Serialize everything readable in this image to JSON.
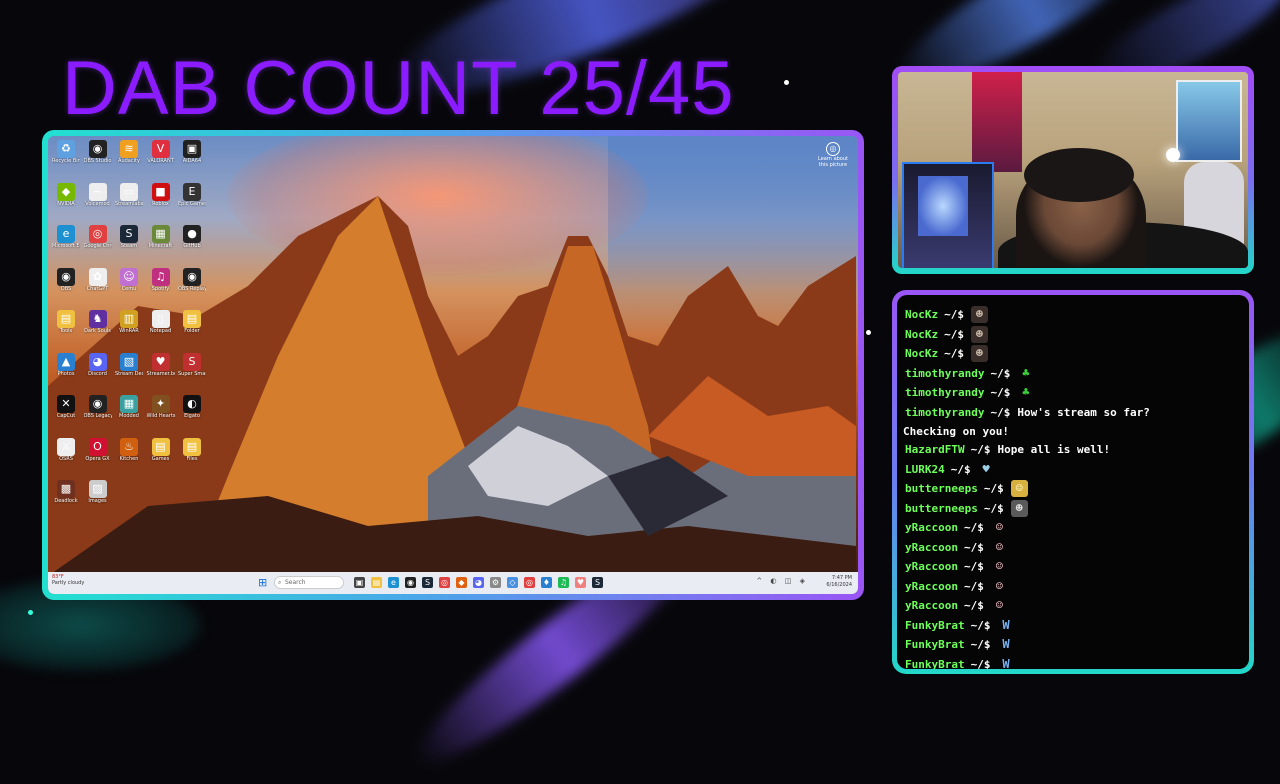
{
  "overlay": {
    "title": "DAB COUNT 25/45"
  },
  "desktop": {
    "icons": [
      {
        "label": "Recycle Bin",
        "color": "#5ea0e0",
        "glyph": "♻"
      },
      {
        "label": "OBS Studio",
        "color": "#222",
        "glyph": "◉"
      },
      {
        "label": "Audacity",
        "color": "#f0a020",
        "glyph": "≋"
      },
      {
        "label": "VALORANT",
        "color": "#e03040",
        "glyph": "V"
      },
      {
        "label": "AIDA64",
        "color": "#202020",
        "glyph": "▣"
      },
      {
        "label": "NVIDIA",
        "color": "#76b900",
        "glyph": "◆"
      },
      {
        "label": "Voicemod",
        "color": "#eee",
        "glyph": "~"
      },
      {
        "label": "Streamlabs",
        "color": "#eee",
        "glyph": "▭"
      },
      {
        "label": "Roblox",
        "color": "#d01010",
        "glyph": "■"
      },
      {
        "label": "Epic Games",
        "color": "#333",
        "glyph": "E"
      },
      {
        "label": "Microsoft Edge",
        "color": "#1c90d0",
        "glyph": "e"
      },
      {
        "label": "Google Chrome",
        "color": "#e04040",
        "glyph": "◎"
      },
      {
        "label": "Steam",
        "color": "#1b2838",
        "glyph": "S"
      },
      {
        "label": "Minecraft",
        "color": "#6a8a3a",
        "glyph": "▦"
      },
      {
        "label": "GitHub",
        "color": "#222",
        "glyph": "●"
      },
      {
        "label": "OBS",
        "color": "#222",
        "glyph": "◉"
      },
      {
        "label": "ChatGPT",
        "color": "#eee",
        "glyph": "✿"
      },
      {
        "label": "Cemu",
        "color": "#c070d0",
        "glyph": "☺"
      },
      {
        "label": "Spotify",
        "color": "#c03080",
        "glyph": "♫"
      },
      {
        "label": "OBS Replay",
        "color": "#222",
        "glyph": "◉"
      },
      {
        "label": "Tools",
        "color": "#f0c040",
        "glyph": "▤"
      },
      {
        "label": "Dark Souls",
        "color": "#6030a0",
        "glyph": "♞"
      },
      {
        "label": "WinRAR",
        "color": "#d0a020",
        "glyph": "▥"
      },
      {
        "label": "Notepad",
        "color": "#eee",
        "glyph": "▯"
      },
      {
        "label": "Folder",
        "color": "#f0c040",
        "glyph": "▤"
      },
      {
        "label": "Photos",
        "color": "#2a80d0",
        "glyph": "▲"
      },
      {
        "label": "Discord",
        "color": "#5865f2",
        "glyph": "◕"
      },
      {
        "label": "Stream Deck",
        "color": "#2a80d0",
        "glyph": "▧"
      },
      {
        "label": "Streamer.bot",
        "color": "#c03030",
        "glyph": "♥"
      },
      {
        "label": "Super Smash",
        "color": "#c03030",
        "glyph": "S"
      },
      {
        "label": "CapCut",
        "color": "#111",
        "glyph": "✕"
      },
      {
        "label": "OBS Legacy",
        "color": "#222",
        "glyph": "◉"
      },
      {
        "label": "Modded",
        "color": "#3aa0a0",
        "glyph": "▦"
      },
      {
        "label": "Wild Hearts",
        "color": "#805020",
        "glyph": "✦"
      },
      {
        "label": "Elgato",
        "color": "#111",
        "glyph": "◐"
      },
      {
        "label": "OSRS",
        "color": "#eee",
        "glyph": "⚔"
      },
      {
        "label": "Opera GX",
        "color": "#d01030",
        "glyph": "O"
      },
      {
        "label": "Kitchen",
        "color": "#d06010",
        "glyph": "♨"
      },
      {
        "label": "Games",
        "color": "#f0c040",
        "glyph": "▤"
      },
      {
        "label": "Files",
        "color": "#f0c040",
        "glyph": "▤"
      },
      {
        "label": "Deadlock",
        "color": "#703020",
        "glyph": "▩"
      },
      {
        "label": "Images",
        "color": "#ccc",
        "glyph": "▨"
      }
    ],
    "notification_label": "Learn about this picture",
    "taskbar": {
      "weather_temp": "83°F",
      "weather_desc": "Partly cloudy",
      "search_placeholder": "Search",
      "clock_time": "7:47 PM",
      "clock_date": "6/16/2024"
    }
  },
  "chat": {
    "prompt": "~/$",
    "continuation": "Checking on you!",
    "messages": [
      {
        "user": "NocKz",
        "text": "",
        "emote": "dark"
      },
      {
        "user": "NocKz",
        "text": "",
        "emote": "dark"
      },
      {
        "user": "NocKz",
        "text": "",
        "emote": "dark"
      },
      {
        "user": "timothyrandy",
        "text": "",
        "emote": "pickle"
      },
      {
        "user": "timothyrandy",
        "text": "",
        "emote": "pickle"
      },
      {
        "user": "timothyrandy",
        "text": "How's stream so far?",
        "emote": ""
      },
      {
        "user": "HazardFTW",
        "text": "Hope all is well!",
        "emote": ""
      },
      {
        "user": "LURK24",
        "text": "",
        "emote": "heart"
      },
      {
        "user": "butterneeps",
        "text": "",
        "emote": "gold"
      },
      {
        "user": "butterneeps",
        "text": "",
        "emote": "grey"
      },
      {
        "user": "yRaccoon",
        "text": "",
        "emote": "ghost"
      },
      {
        "user": "yRaccoon",
        "text": "",
        "emote": "ghost"
      },
      {
        "user": "yRaccoon",
        "text": "",
        "emote": "ghost"
      },
      {
        "user": "yRaccoon",
        "text": "",
        "emote": "ghost"
      },
      {
        "user": "yRaccoon",
        "text": "",
        "emote": "ghost"
      },
      {
        "user": "FunkyBrat",
        "text": "",
        "emote": "W"
      },
      {
        "user": "FunkyBrat",
        "text": "",
        "emote": "W"
      },
      {
        "user": "FunkyBrat",
        "text": "",
        "emote": "W"
      }
    ]
  }
}
